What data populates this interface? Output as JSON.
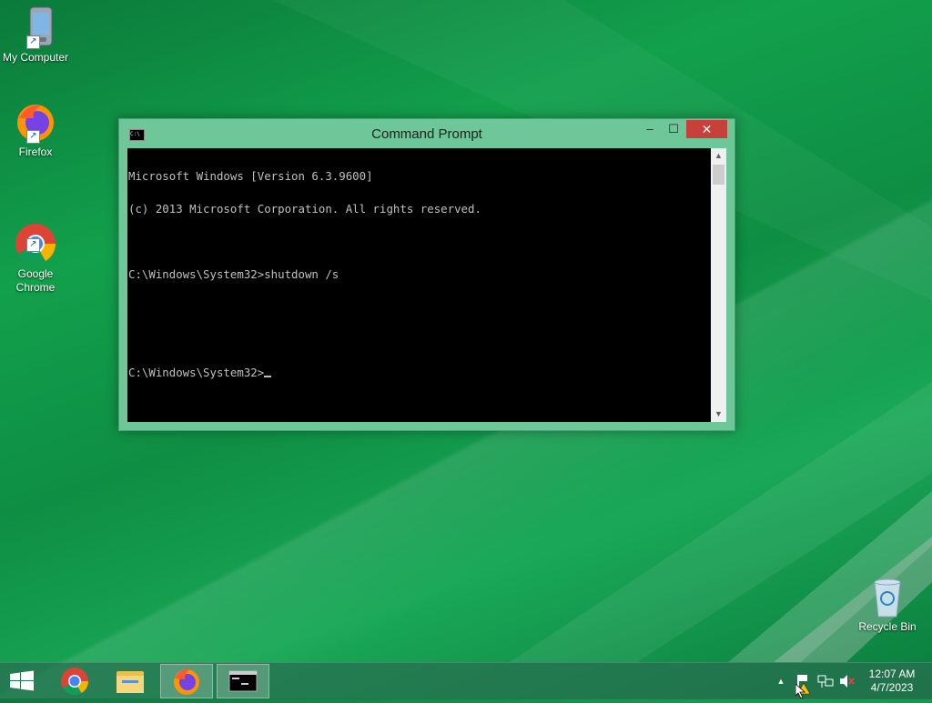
{
  "desktop": {
    "icons": [
      {
        "label": "My Computer"
      },
      {
        "label": "Firefox"
      },
      {
        "label": "Google\nChrome"
      },
      {
        "label": "Recycle Bin"
      }
    ]
  },
  "window": {
    "title": "Command Prompt",
    "minimize_glyph": "–",
    "maximize_glyph": "☐",
    "close_glyph": "✕",
    "console_lines": [
      "Microsoft Windows [Version 6.3.9600]",
      "(c) 2013 Microsoft Corporation. All rights reserved.",
      "",
      "C:\\Windows\\System32>shutdown /s",
      "",
      "",
      "C:\\Windows\\System32>"
    ],
    "scroll_up_glyph": "▲",
    "scroll_down_glyph": "▼"
  },
  "taskbar": {
    "items": [
      "start-button",
      "chrome",
      "file-explorer",
      "firefox",
      "command-prompt"
    ],
    "active_item": "command-prompt",
    "tray": {
      "show_hidden_glyph": "▲"
    },
    "clock": {
      "time": "12:07 AM",
      "date": "4/7/2023"
    }
  },
  "colors": {
    "desktop": "#12a04c",
    "window_frame": "#6ec798",
    "close_button": "#c7403a",
    "console_bg": "#000000",
    "console_text": "#c0c0c0"
  }
}
